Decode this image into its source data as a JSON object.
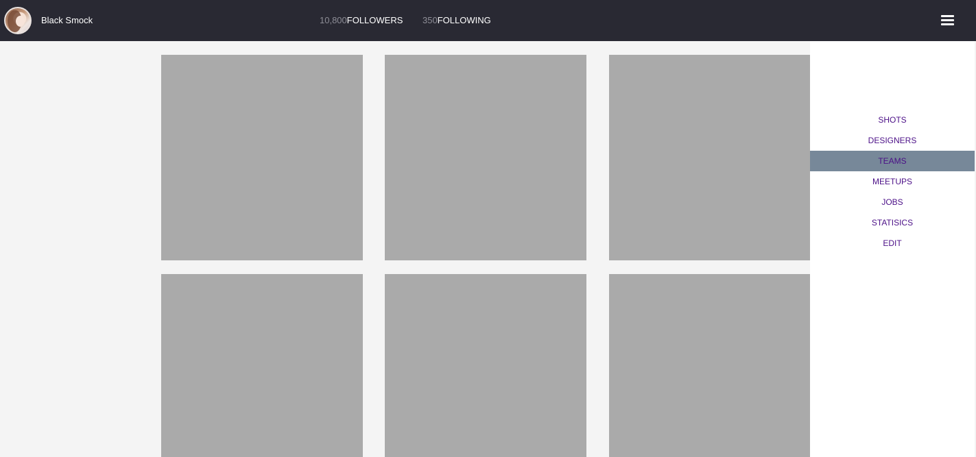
{
  "profile": {
    "name": "Black Smock",
    "avatar_icon": "user-avatar-photo"
  },
  "stats": {
    "followers": {
      "count": "10,800",
      "label": "FOLLOWERS"
    },
    "following": {
      "count": "350",
      "label": "FOLLOWING"
    }
  },
  "header": {
    "menu_icon": "hamburger-menu-icon",
    "background": "#292933"
  },
  "grid": {
    "tile_color": "#aaaaaa",
    "tiles": [
      {
        "id": "shot-1"
      },
      {
        "id": "shot-2"
      },
      {
        "id": "shot-3"
      },
      {
        "id": "shot-4"
      },
      {
        "id": "shot-5"
      },
      {
        "id": "shot-6"
      }
    ]
  },
  "sidenav": {
    "link_color": "#4b0f87",
    "active_color": "#778899",
    "active_item": "TEAMS",
    "items": [
      {
        "label": "SHOTS"
      },
      {
        "label": "DESIGNERS"
      },
      {
        "label": "TEAMS"
      },
      {
        "label": "MEETUPS"
      },
      {
        "label": "JOBS"
      },
      {
        "label": "STATISICS"
      },
      {
        "label": "EDIT"
      }
    ]
  }
}
